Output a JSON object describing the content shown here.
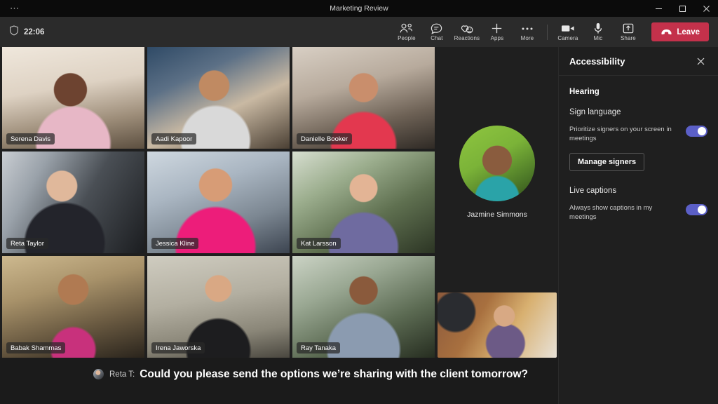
{
  "window": {
    "title": "Marketing Review",
    "overflow_icon": "ellipsis-icon",
    "minimize_label": "Minimize",
    "maximize_label": "Maximize",
    "close_label": "Close"
  },
  "header": {
    "shield_icon": "shield-icon",
    "timer": "22:06",
    "tools": [
      {
        "label": "People",
        "icon": "people-icon"
      },
      {
        "label": "Chat",
        "icon": "chat-icon"
      },
      {
        "label": "Reactions",
        "icon": "reactions-icon"
      },
      {
        "label": "Apps",
        "icon": "plus-icon"
      },
      {
        "label": "More",
        "icon": "ellipsis-icon"
      },
      {
        "label": "Camera",
        "icon": "camera-icon"
      },
      {
        "label": "Mic",
        "icon": "microphone-icon"
      },
      {
        "label": "Share",
        "icon": "share-screen-icon"
      }
    ],
    "leave": {
      "label": "Leave",
      "icon": "hangup-icon",
      "color": "#c4314b"
    }
  },
  "stage": {
    "active_speaker_color": "#5b5fc7",
    "tiles": [
      {
        "name": "Serena Davis",
        "active": false
      },
      {
        "name": "Aadi Kapoor",
        "active": false
      },
      {
        "name": "Danielle Booker",
        "active": false
      },
      {
        "name": "Reta Taylor",
        "active": true
      },
      {
        "name": "Jessica Kline",
        "active": false
      },
      {
        "name": "Kat Larsson",
        "active": false
      },
      {
        "name": "Babak Shammas",
        "active": false
      },
      {
        "name": "Irena Jaworska",
        "active": false
      },
      {
        "name": "Ray Tanaka",
        "active": false
      }
    ],
    "avatar_participant": {
      "name": "Jazmine Simmons"
    },
    "self_view": {
      "name": "self-view-tile"
    }
  },
  "captions": {
    "speaker": "Reta T:",
    "text": "Could you please send the options we’re sharing with the client tomorrow?",
    "avatar_icon": "speaker-avatar"
  },
  "panel": {
    "title": "Accessibility",
    "close_icon": "close-icon",
    "section": "Hearing",
    "sign_language": {
      "group": "Sign language",
      "setting_label": "Prioritize signers on your screen in meetings",
      "toggle_state": "on",
      "button_label": "Manage signers"
    },
    "live_captions": {
      "group": "Live captions",
      "setting_label": "Always show captions in my meetings",
      "toggle_state": "on"
    },
    "accent_color": "#5b5fc7"
  }
}
